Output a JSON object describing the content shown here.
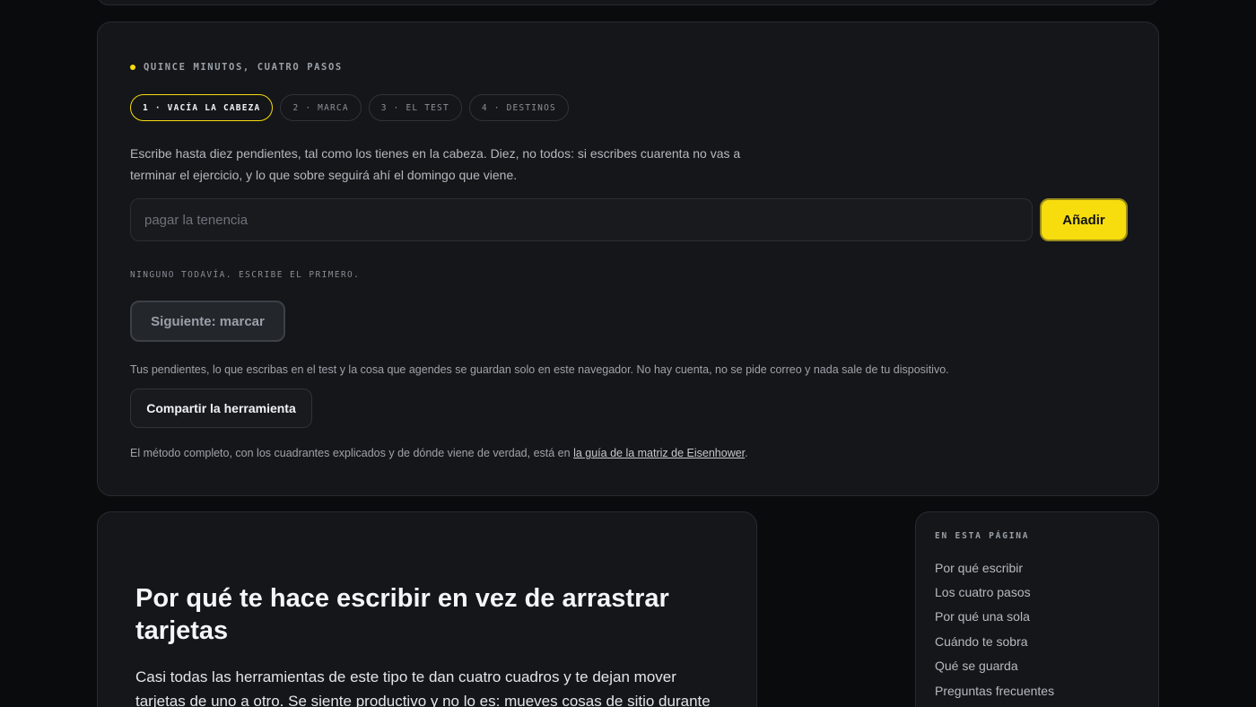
{
  "tool": {
    "eyebrow": "Quince minutos, cuatro pasos",
    "steps": [
      {
        "label": "1 · Vacía la cabeza",
        "active": true
      },
      {
        "label": "2 · Marca",
        "active": false
      },
      {
        "label": "3 · El test",
        "active": false
      },
      {
        "label": "4 · Destinos",
        "active": false
      }
    ],
    "intro": "Escribe hasta diez pendientes, tal como los tienes en la cabeza. Diez, no todos: si escribes cuarenta no vas a terminar el ejercicio, y lo que sobre seguirá ahí el domingo que viene.",
    "input_placeholder": "pagar la tenencia",
    "input_value": "",
    "add_label": "Añadir",
    "empty_note": "Ninguno todavía. Escribe el primero.",
    "next_label": "Siguiente: marcar",
    "privacy": "Tus pendientes, lo que escribas en el test y la cosa que agendes se guardan solo en este navegador. No hay cuenta, no se pide correo y nada sale de tu dispositivo.",
    "share_label": "Compartir la herramienta",
    "method_prefix": "El método completo, con los cuadrantes explicados y de dónde viene de verdad, está en ",
    "method_link": "la guía de la matriz de Eisenhower",
    "method_suffix": "."
  },
  "article": {
    "title": "Por qué te hace escribir en vez de arrastrar tarjetas",
    "body": "Casi todas las herramientas de este tipo te dan cuatro cuadros y te dejan mover tarjetas de uno a otro. Se siente productivo y no lo es: mueves cosas de sitio durante"
  },
  "toc": {
    "title": "En esta página",
    "items": [
      "Por qué escribir",
      "Los cuatro pasos",
      "Por qué una sola",
      "Cuándo te sobra",
      "Qué se guarda",
      "Preguntas frecuentes"
    ]
  },
  "colors": {
    "accent": "#f7dd0d",
    "background": "#0a0b0d",
    "card": "#141619"
  }
}
